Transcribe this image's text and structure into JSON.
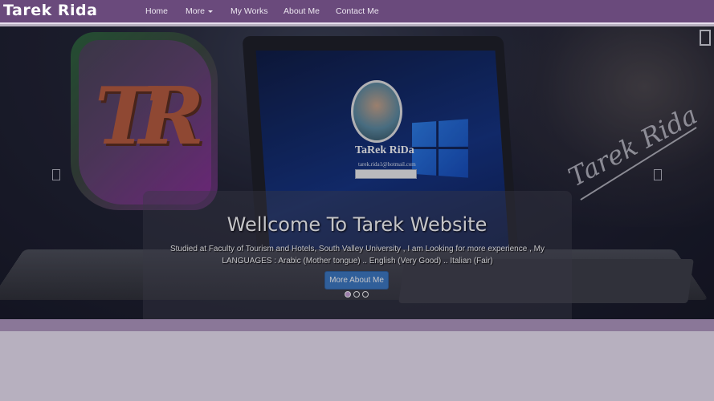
{
  "brand": "Tarek Rida",
  "nav": {
    "items": [
      {
        "label": "Home"
      },
      {
        "label": "More",
        "dropdown": true
      },
      {
        "label": "My Works"
      },
      {
        "label": "About Me"
      },
      {
        "label": "Contact Me"
      }
    ]
  },
  "hero": {
    "avatar_name": "TaRek RiDa",
    "avatar_email": "tarek.rida1@hotmail.com",
    "logo_text": "TR",
    "signature": "Tarek Rida"
  },
  "carousel": {
    "title": "Wellcome To Tarek Website",
    "text": "Studied at Faculty of Tourism and Hotels, South Valley University , I am Looking for more experience , My LANGUAGES : Arabic (Mother tongue) .. English (Very Good) .. Italian (Fair)",
    "button_label": "More About Me",
    "indicator_count": 3,
    "active_index": 0
  },
  "colors": {
    "navbar": "#6a4a7c",
    "button": "#3a78c3",
    "page_background": "#b7b0bf",
    "band": "#8a7798"
  },
  "icons": [
    "carousel-prev-icon",
    "carousel-next-icon",
    "caret-down-icon"
  ]
}
